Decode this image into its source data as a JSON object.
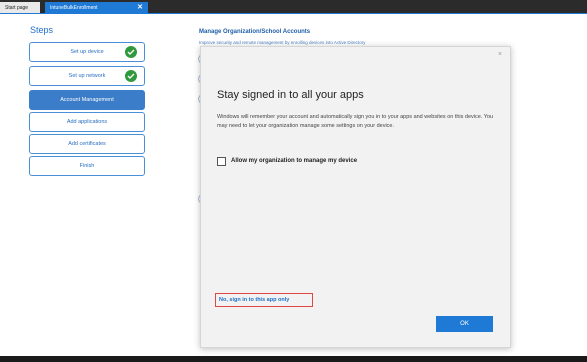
{
  "tabs": [
    {
      "label": "Start page"
    },
    {
      "label": "IntuneBulkEnrollment",
      "close": "✕"
    }
  ],
  "steps": {
    "title": "Steps",
    "items": [
      {
        "label": "Set up device"
      },
      {
        "label": "Set up network"
      },
      {
        "label": "Account Management"
      },
      {
        "label": "Add applications"
      },
      {
        "label": "Add certificates"
      },
      {
        "label": "Finish"
      }
    ]
  },
  "content": {
    "title": "Manage Organization/School Accounts",
    "subtitle": "Improve security and remote management by enrolling devices into Active Directory"
  },
  "dialog": {
    "close": "×",
    "title": "Stay signed in to all your apps",
    "body": "Windows will remember your account and automatically sign you in to your apps and websites on this device. You may need to let your organization manage some settings on your device.",
    "checkbox_label": "Allow my organization to manage my device",
    "link": "No, sign in to this app only",
    "ok": "OK"
  },
  "colors": {
    "accent": "#1f7ad6",
    "success": "#2f9a3b",
    "highlight": "#e04747"
  }
}
